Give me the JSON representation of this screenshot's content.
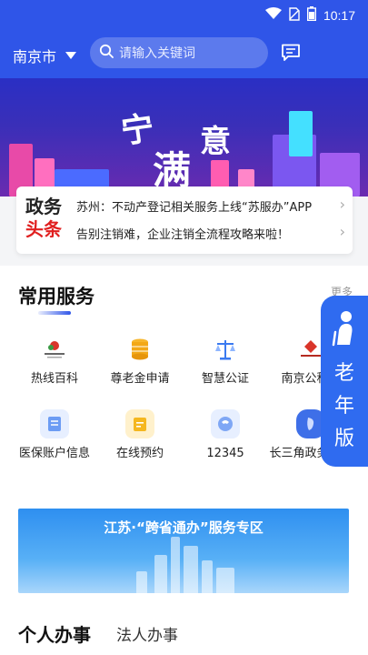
{
  "status_bar": {
    "time": "10:17"
  },
  "header": {
    "city": "南京市",
    "search_placeholder": "请输入关键词"
  },
  "banner": {
    "slogan_1": "宁",
    "slogan_2": "满",
    "slogan_3": "意"
  },
  "news": {
    "tag_line1": "政务",
    "tag_line2": "头条",
    "items": [
      "苏州：不动产登记相关服务上线“苏服办”APP",
      "告别注销难，企业注销全流程攻略来啦！"
    ]
  },
  "services": {
    "title": "常用服务",
    "more_label": "更多",
    "items": [
      {
        "label": "热线百科",
        "icon": "hotline-logo-icon"
      },
      {
        "label": "尊老金申请",
        "icon": "coin-stack-icon"
      },
      {
        "label": "智慧公证",
        "icon": "scale-icon"
      },
      {
        "label": "南京公积金",
        "icon": "housing-fund-logo-icon"
      },
      {
        "label": "医保账户信息",
        "icon": "medical-card-icon"
      },
      {
        "label": "在线预约",
        "icon": "calendar-icon"
      },
      {
        "label": "12345",
        "icon": "phone-icon"
      },
      {
        "label": "长三角政务地图",
        "icon": "map-icon"
      }
    ]
  },
  "elder_mode": {
    "label_line1": "老",
    "label_line2": "年",
    "label_line3": "版"
  },
  "promo": {
    "title": "江苏·“跨省通办”服务专区"
  },
  "tabs": {
    "personal": "个人办事",
    "corporate": "法人办事"
  },
  "colors": {
    "primary": "#2f55e8",
    "accent_red": "#e02020",
    "elder": "#2f6bf0"
  }
}
